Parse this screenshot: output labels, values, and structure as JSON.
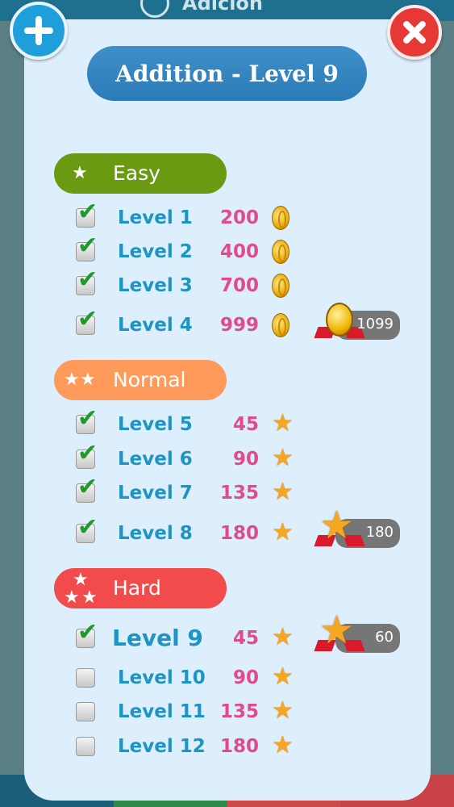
{
  "background": {
    "header_title": "Adición",
    "bottom_colors": [
      "#1b5e78",
      "#2c8a4c",
      "#d0494a",
      "#c84145"
    ]
  },
  "dialog": {
    "title": "Addition - Level 9",
    "add_icon": "plus-icon",
    "close_icon": "close-icon"
  },
  "colors": {
    "easy": "#6a9a12",
    "normal": "#ff9a5a",
    "hard": "#f24b4b",
    "level_text": "#1c94c4",
    "reward_text": "#e04b8a"
  },
  "sections": [
    {
      "label": "Easy",
      "stars": 1,
      "levels": [
        {
          "label": "Level 1",
          "reward": "200",
          "icon": "coin-icon",
          "checked": true
        },
        {
          "label": "Level 2",
          "reward": "400",
          "icon": "coin-icon",
          "checked": true
        },
        {
          "label": "Level 3",
          "reward": "700",
          "icon": "coin-icon",
          "checked": true
        },
        {
          "label": "Level 4",
          "reward": "999",
          "icon": "coin-icon",
          "checked": true
        }
      ],
      "bonus": {
        "amount": "1099",
        "icon": "coin-icon"
      }
    },
    {
      "label": "Normal",
      "stars": 2,
      "levels": [
        {
          "label": "Level 5",
          "reward": "45",
          "icon": "star-icon",
          "checked": true
        },
        {
          "label": "Level 6",
          "reward": "90",
          "icon": "star-icon",
          "checked": true
        },
        {
          "label": "Level 7",
          "reward": "135",
          "icon": "star-icon",
          "checked": true
        },
        {
          "label": "Level 8",
          "reward": "180",
          "icon": "star-icon",
          "checked": true
        }
      ],
      "bonus": {
        "amount": "180",
        "icon": "star-icon"
      }
    },
    {
      "label": "Hard",
      "stars": 3,
      "levels": [
        {
          "label": "Level 9",
          "reward": "45",
          "icon": "star-icon",
          "checked": true,
          "current": true
        },
        {
          "label": "Level 10",
          "reward": "90",
          "icon": "star-icon",
          "checked": false
        },
        {
          "label": "Level 11",
          "reward": "135",
          "icon": "star-icon",
          "checked": false
        },
        {
          "label": "Level 12",
          "reward": "180",
          "icon": "star-icon",
          "checked": false
        }
      ],
      "bonus": {
        "amount": "60",
        "icon": "star-icon"
      }
    }
  ]
}
